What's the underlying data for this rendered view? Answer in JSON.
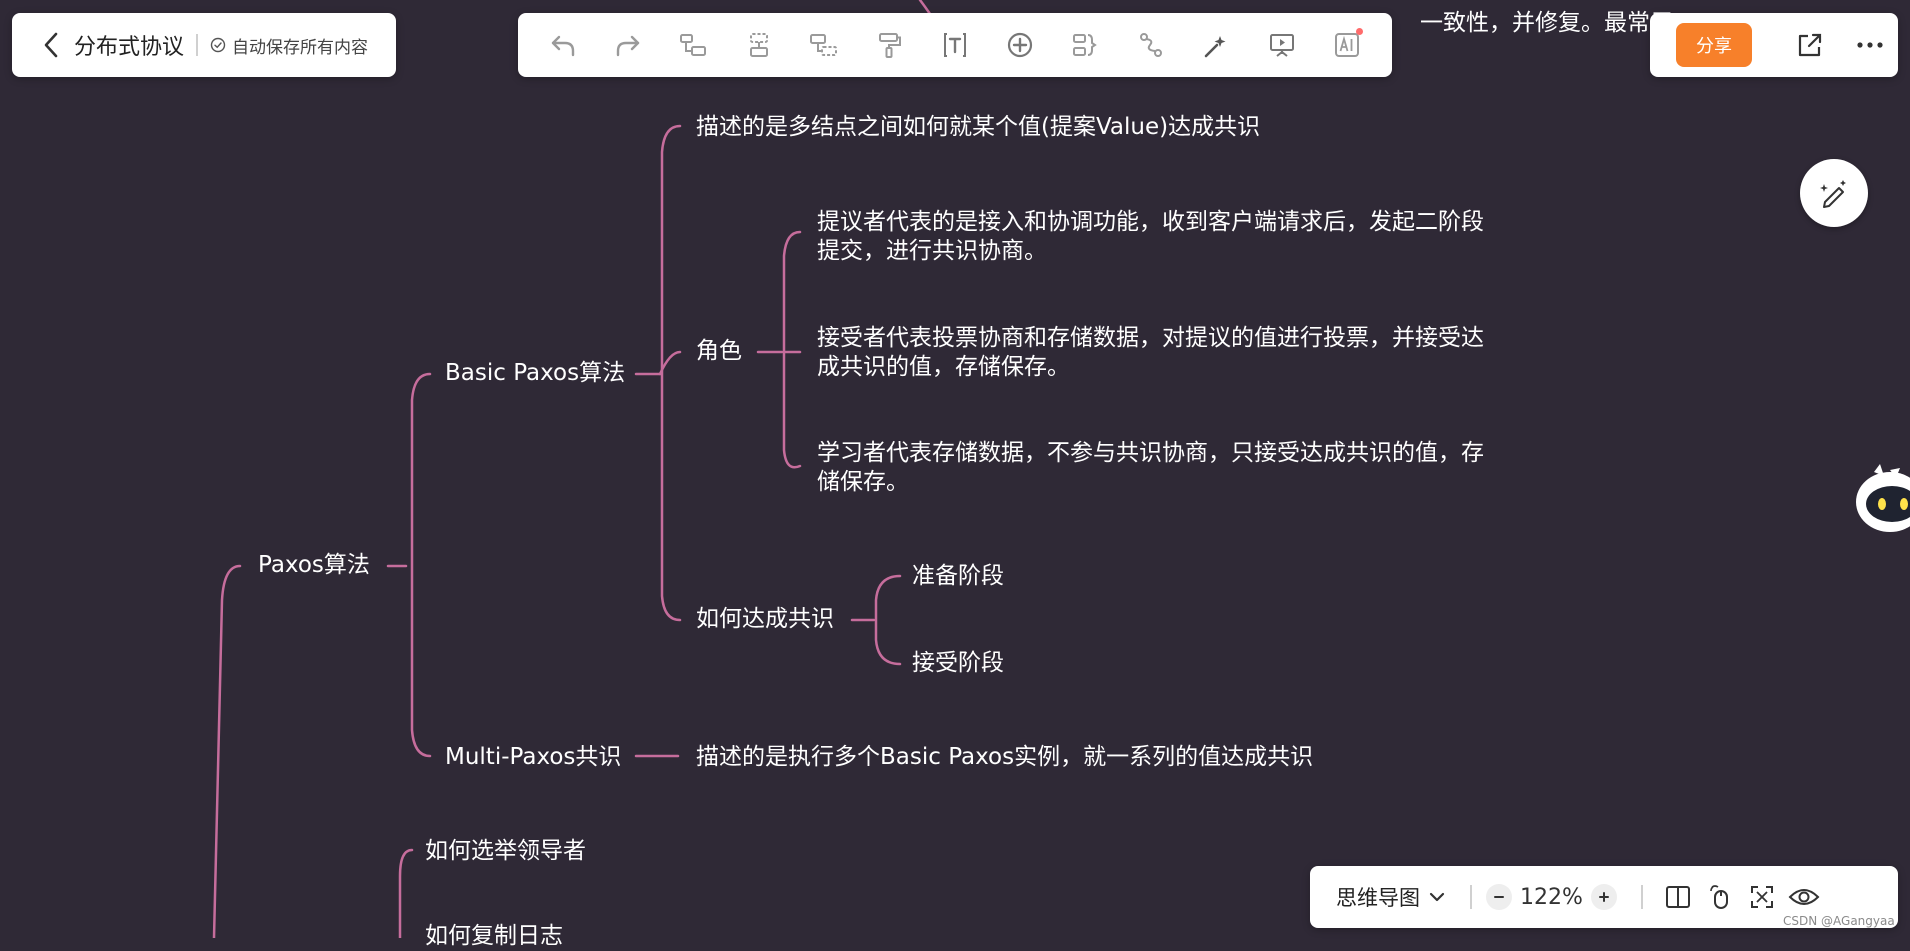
{
  "header": {
    "doc_title": "分布式协议",
    "save_status": "自动保存所有内容"
  },
  "toolbar": {
    "tools": [
      {
        "icon": "undo-icon"
      },
      {
        "icon": "redo-icon"
      },
      {
        "icon": "insert-child-topic-icon"
      },
      {
        "icon": "insert-sibling-topic-icon"
      },
      {
        "icon": "insert-parent-topic-icon"
      },
      {
        "icon": "format-painter-icon"
      },
      {
        "icon": "text-icon"
      },
      {
        "icon": "add-icon"
      },
      {
        "icon": "summary-icon"
      },
      {
        "icon": "relation-line-icon"
      },
      {
        "icon": "magic-wand-icon"
      },
      {
        "icon": "presentation-icon"
      },
      {
        "icon": "ai-icon"
      }
    ]
  },
  "share": {
    "share_label": "分享"
  },
  "mindmap": {
    "top_partial_text": "一致性，并修复。最常用",
    "root": "Paxos算法",
    "basic": "Basic Paxos算法",
    "basic_desc": "描述的是多结点之间如何就某个值(提案Value)达成共识",
    "roles": "角色",
    "role_proposer": "提议者代表的是接入和协调功能，收到客户端请求后，发起二阶段提交，进行共识协商。",
    "role_acceptor": "接受者代表投票协商和存储数据，对提议的值进行投票，并接受达成共识的值，存储保存。",
    "role_learner": "学习者代表存储数据，不参与共识协商，只接受达成共识的值，存储保存。",
    "consensus": "如何达成共识",
    "prepare_phase": "准备阶段",
    "accept_phase": "接受阶段",
    "multi": "Multi-Paxos共识",
    "multi_desc": "描述的是执行多个Basic Paxos实例，就一系列的值达成共识",
    "leader_election": "如何选举领导者",
    "log_replication": "如何复制日志"
  },
  "bottom_bar": {
    "view_mode": "思维导图",
    "zoom": "122%"
  },
  "watermark": "CSDN @AGangyaa",
  "colors": {
    "canvas_bg": "#2f2936",
    "branch_line": "#c66d9c",
    "share_button": "#f7802a"
  }
}
